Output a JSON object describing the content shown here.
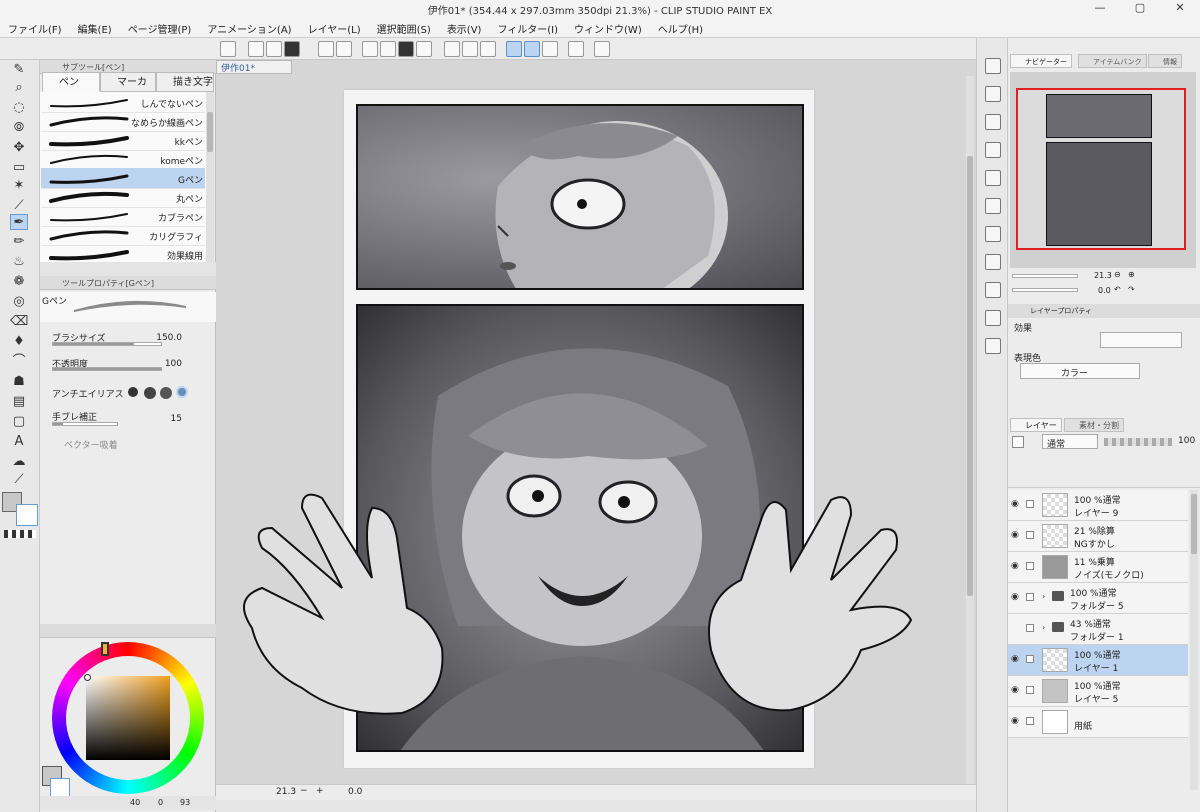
{
  "titlebar": {
    "title": "伊作01* (354.44 x 297.03mm 350dpi 21.3%) - CLIP STUDIO PAINT EX",
    "minimize": "—",
    "maximize": "▢",
    "close": "✕"
  },
  "menu": [
    "ファイル(F)",
    "編集(E)",
    "ページ管理(P)",
    "アニメーション(A)",
    "レイヤー(L)",
    "選択範囲(S)",
    "表示(V)",
    "フィルター(I)",
    "ウィンドウ(W)",
    "ヘルプ(H)"
  ],
  "subtool_panel": {
    "header": "サブツール[ペン]",
    "tabs": [
      "ペン",
      "マーカー",
      "描き文字"
    ],
    "brushes": [
      "しんでないペン",
      "なめらか線画ペン",
      "kkペン",
      "komeペン",
      "Gペン",
      "丸ペン",
      "カブラペン",
      "カリグラフィ",
      "効果線用"
    ],
    "selected_brush": "Gペン"
  },
  "tool_property": {
    "header": "ツールプロパティ[Gペン]",
    "brush_name": "Gペン",
    "brush_size_label": "ブラシサイズ",
    "brush_size_value": "150.0",
    "brush_size_fraction": 0.75,
    "opacity_label": "不透明度",
    "opacity_value": "100",
    "opacity_fraction": 1.0,
    "antialias_label": "アンチエイリアス",
    "stabilize_label": "手ブレ補正",
    "stabilize_value": "15",
    "stabilize_fraction": 0.15,
    "vector_label": "ベクター吸着"
  },
  "color_panel": {
    "hue_marker": "orange",
    "main_color": "#c8c8c8",
    "status_left": "40",
    "status_mid": "0",
    "status_right": "93"
  },
  "canvas": {
    "doc_tab": "伊作01*",
    "zoom": "21.3",
    "rotation": "0.0"
  },
  "navigator": {
    "tabs": [
      "ナビゲーター",
      "アイテムバンク",
      "情報"
    ],
    "zoom_value": "21.3",
    "rotate_value": "0.0"
  },
  "layer_property": {
    "header": "レイヤープロパティ",
    "effect_label": "効果",
    "color_label": "表現色",
    "color_value": "カラー"
  },
  "layers_panel": {
    "tabs": [
      "レイヤー",
      "素材・分割"
    ],
    "blend_mode": "通常",
    "opacity": "100",
    "layers": [
      {
        "mode": "100 %通常",
        "name": "レイヤー 9",
        "kind": "raster",
        "selected": false,
        "visible": true
      },
      {
        "mode": "21 %除算",
        "name": "NGすかし",
        "kind": "raster",
        "selected": false,
        "visible": true
      },
      {
        "mode": "11 %乗算",
        "name": "ノイズ(モノクロ)",
        "kind": "mask",
        "selected": false,
        "visible": true
      },
      {
        "mode": "100 %通常",
        "name": "フォルダー 5",
        "kind": "folder",
        "selected": false,
        "visible": true
      },
      {
        "mode": "43 %通常",
        "name": "フォルダー 1",
        "kind": "folder",
        "selected": false,
        "visible": false
      },
      {
        "mode": "100 %通常",
        "name": "レイヤー 1",
        "kind": "raster",
        "selected": true,
        "visible": true
      },
      {
        "mode": "100 %通常",
        "name": "レイヤー 5",
        "kind": "gray",
        "selected": false,
        "visible": true
      },
      {
        "mode": "",
        "name": "用紙",
        "kind": "paper",
        "selected": false,
        "visible": true
      }
    ]
  },
  "colors": {
    "accent": "#bcd4ef",
    "nav_frame": "#e02020"
  }
}
